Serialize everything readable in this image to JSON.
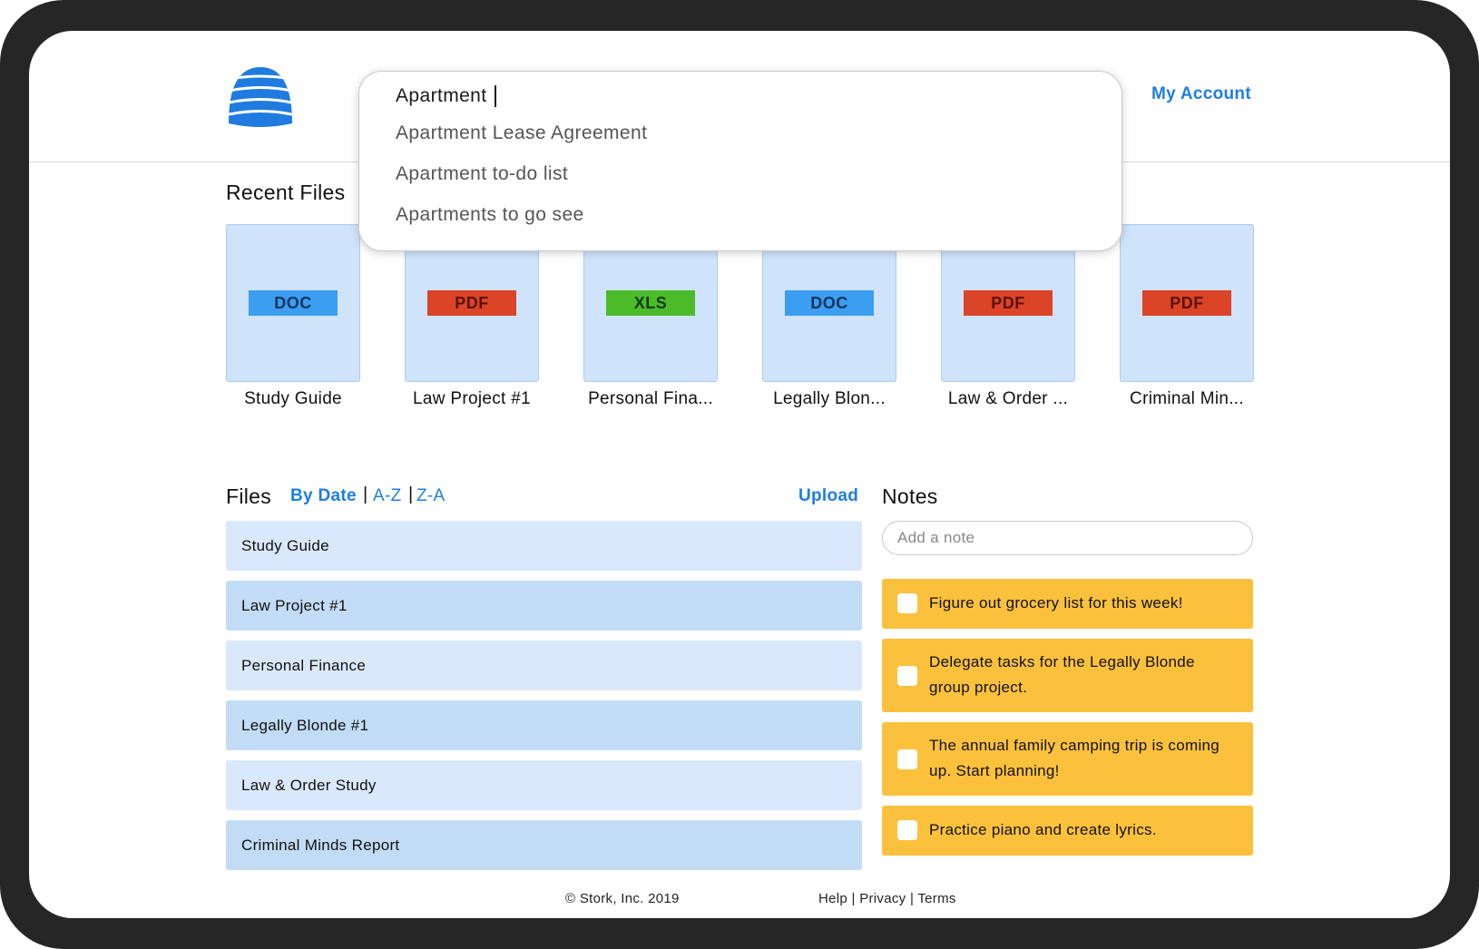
{
  "header": {
    "logo_icon": "stork-beehive-logo-icon",
    "my_account": "My Account"
  },
  "search": {
    "value": "Apartment",
    "suggestions": [
      "Apartment Lease Agreement",
      "Apartment to-do list",
      "Apartments to go see"
    ]
  },
  "recent_files": {
    "title": "Recent Files",
    "items": [
      {
        "type": "DOC",
        "label": "Study Guide"
      },
      {
        "type": "PDF",
        "label": "Law Project #1"
      },
      {
        "type": "XLS",
        "label": "Personal Fina..."
      },
      {
        "type": "DOC",
        "label": "Legally Blon..."
      },
      {
        "type": "PDF",
        "label": "Law & Order ..."
      },
      {
        "type": "PDF",
        "label": "Criminal Min..."
      }
    ]
  },
  "files": {
    "title": "Files",
    "sort_by_date": "By Date",
    "sort_az": "A-Z",
    "sort_za": "Z-A",
    "separator": "|",
    "upload": "Upload",
    "rows": [
      "Study Guide",
      "Law Project #1",
      "Personal Finance",
      "Legally Blonde #1",
      "Law & Order Study",
      "Criminal Minds Report"
    ]
  },
  "notes": {
    "title": "Notes",
    "placeholder": "Add a note",
    "items": [
      "Figure out grocery list for this week!",
      "Delegate tasks for the Legally Blonde group project.",
      "The annual family camping trip is coming up. Start planning!",
      "Practice piano and create lyrics."
    ]
  },
  "footer": {
    "copyright": "© Stork, Inc. 2019",
    "help": "Help",
    "privacy": "Privacy",
    "terms": "Terms",
    "separator": "|"
  },
  "colors": {
    "accent": "#1e7ee0",
    "doc_badge": "#3c9ef0",
    "pdf_badge": "#db4426",
    "xls_badge": "#4cbb2a",
    "card_bg": "#cfe3fb",
    "note_bg": "#fbc13d",
    "bezel": "#262626"
  }
}
